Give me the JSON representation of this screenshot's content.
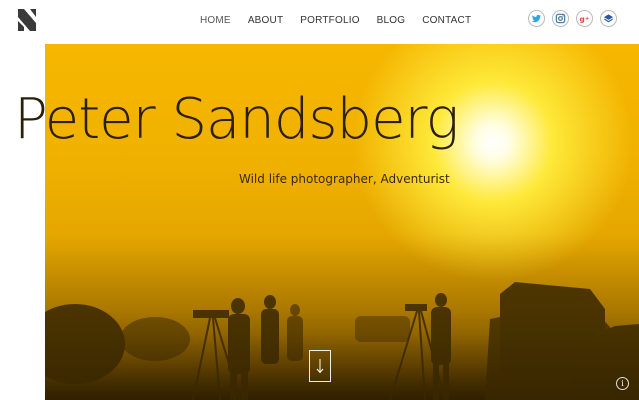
{
  "nav": {
    "items": [
      {
        "label": "HOME",
        "active": true
      },
      {
        "label": "ABOUT",
        "active": false
      },
      {
        "label": "PORTFOLIO",
        "active": false
      },
      {
        "label": "BLOG",
        "active": false
      },
      {
        "label": "CONTACT",
        "active": false
      }
    ]
  },
  "social": [
    {
      "icon": "twitter-icon",
      "color": "#29a9e0"
    },
    {
      "icon": "instagram-icon",
      "color": "#517fa4"
    },
    {
      "icon": "google-plus-icon",
      "color": "#dd4b39"
    },
    {
      "icon": "layers-icon",
      "color": "#2c5aa0"
    }
  ],
  "hero": {
    "title": "Peter Sandsberg",
    "subtitle": "Wild life photographer, Adventurist",
    "scroll_icon": "down-arrow-icon",
    "info_icon": "info-icon",
    "info_glyph": "i"
  },
  "colors": {
    "sky_top": "#f6b700",
    "sun": "#ffffff",
    "title_text": "#2b1f0a"
  }
}
